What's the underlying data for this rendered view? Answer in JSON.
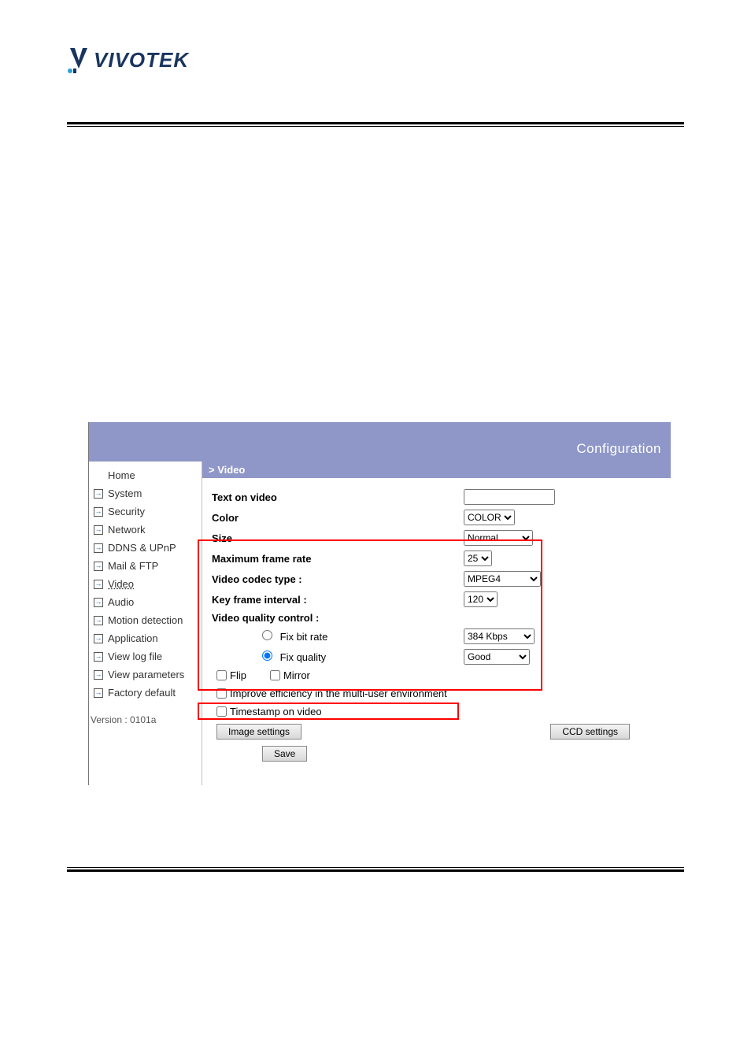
{
  "logo_text": "VIVOTEK",
  "header": {
    "title": "Configuration"
  },
  "sidebar": {
    "home": "Home",
    "items": [
      "System",
      "Security",
      "Network",
      "DDNS & UPnP",
      "Mail & FTP",
      "Video",
      "Audio",
      "Motion detection",
      "Application",
      "View log file",
      "View parameters",
      "Factory default"
    ],
    "version_label": "Version : 0101a"
  },
  "section_title": "> Video",
  "form": {
    "text_on_video_label": "Text on video",
    "text_on_video_value": "",
    "color_label": "Color",
    "color_value": "COLOR",
    "size_label": "Size",
    "size_value": "Normal",
    "max_frame_label": "Maximum frame rate",
    "max_frame_value": "25",
    "codec_label": "Video codec type :",
    "codec_value": "MPEG4",
    "key_frame_label": "Key frame interval :",
    "key_frame_value": "120",
    "vqc_label": "Video quality control :",
    "fix_bitrate_label": "Fix bit rate",
    "fix_bitrate_value": "384 Kbps",
    "fix_quality_label": "Fix quality",
    "fix_quality_value": "Good",
    "flip_label": "Flip",
    "mirror_label": "Mirror",
    "improve_label": "Improve efficiency in the multi-user environment",
    "timestamp_label": "Timestamp on video",
    "image_settings_btn": "Image settings",
    "ccd_settings_btn": "CCD settings",
    "save_btn": "Save"
  }
}
